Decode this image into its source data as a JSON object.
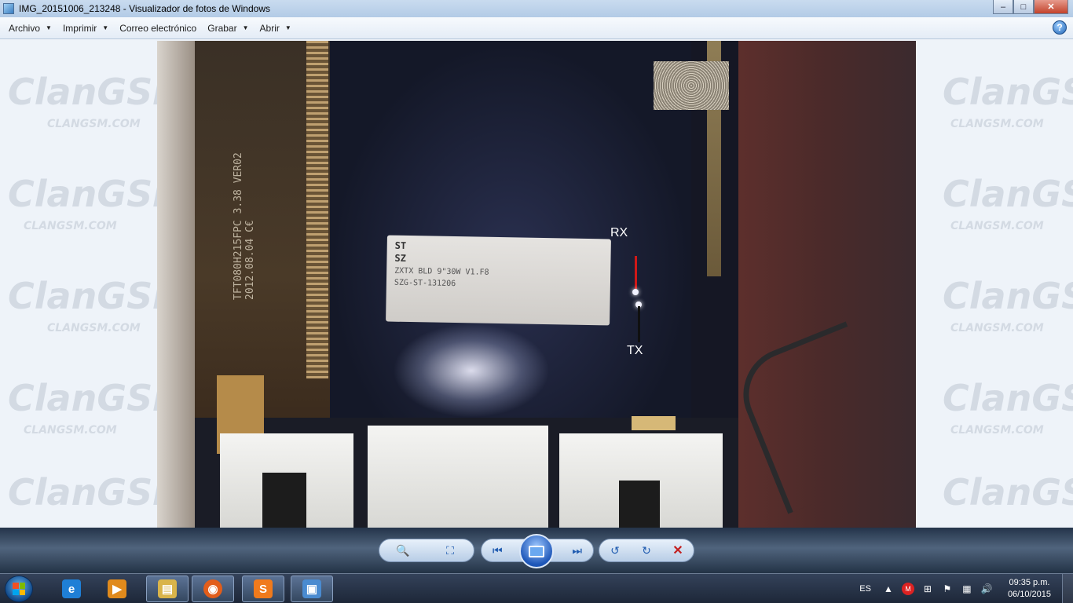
{
  "window": {
    "title": "IMG_20151006_213248 - Visualizador de fotos de Windows",
    "controls": {
      "minimize": "–",
      "maximize": "□",
      "close": "✕"
    }
  },
  "menu": {
    "items": [
      {
        "label": "Archivo"
      },
      {
        "label": "Imprimir"
      },
      {
        "label": "Correo electrónico"
      },
      {
        "label": "Grabar"
      },
      {
        "label": "Abrir"
      }
    ],
    "help": "?"
  },
  "watermark": {
    "brand": "ClanGSM",
    "brand_caps": "CLANGSM",
    "site": "CLANGSM.COM"
  },
  "photo": {
    "flex_print": "TFT080H215FPC  3.38  VER02 2012.08.04  C€",
    "label_lines": [
      "ST",
      "SZ",
      "ZXTX BLD 9\"30W V1.F8",
      "SZG-ST-131206"
    ],
    "rx_label": "RX",
    "tx_label": "TX",
    "colors": {
      "rx_pointer": "#d01818",
      "tx_pointer": "#101010"
    }
  },
  "toolbar": {
    "zoom": "🔍",
    "fit": "⛶",
    "prev": "⏮",
    "next": "⏭",
    "rotate_ccw": "↺",
    "rotate_cw": "↻",
    "delete": "✕"
  },
  "taskbar": {
    "apps": [
      {
        "name": "internet-explorer",
        "glyph": "e",
        "color": "#1f7fd6"
      },
      {
        "name": "media-player",
        "glyph": "▶",
        "color": "#e08a1c"
      },
      {
        "name": "file-explorer",
        "glyph": "▤",
        "color": "#d9b44a"
      },
      {
        "name": "firefox",
        "glyph": "◉",
        "color": "#e25d1a"
      },
      {
        "name": "s-app",
        "glyph": "S",
        "color": "#f07a1c"
      },
      {
        "name": "photo-viewer",
        "glyph": "▣",
        "color": "#4a8bd0"
      }
    ],
    "tray": {
      "lang": "ES",
      "time": "09:35 p.m.",
      "date": "06/10/2015"
    }
  }
}
